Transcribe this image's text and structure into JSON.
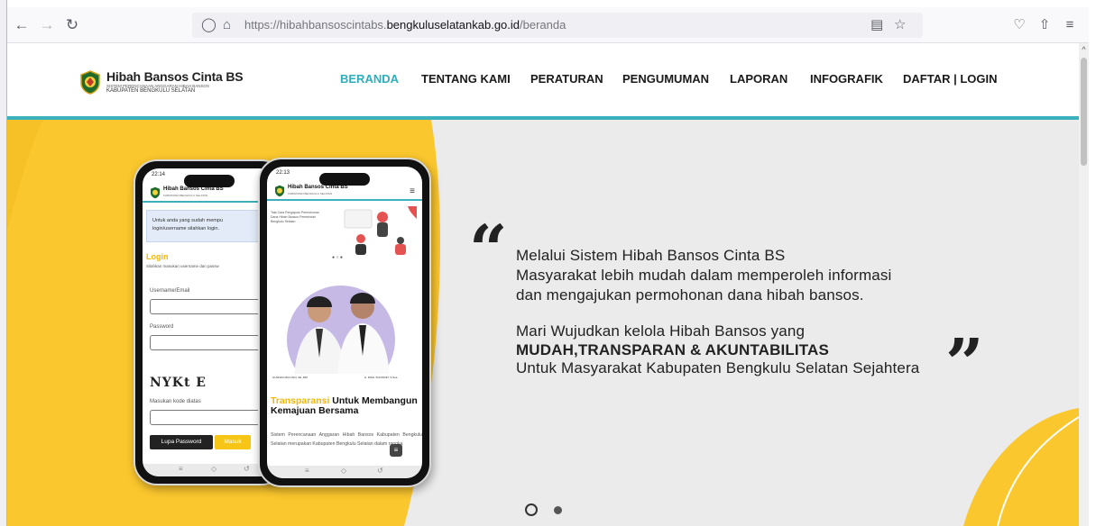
{
  "browser": {
    "url_prefix": "https://hibahbansoscintabs.",
    "url_domain": "bengkuluselatankab.go.id",
    "url_path": "/beranda",
    "icons": [
      "back-arrow-icon",
      "forward-arrow-icon",
      "reload-icon",
      "shield-icon",
      "lock-icon",
      "reader-view-icon",
      "bookmark-star-icon",
      "pocket-icon",
      "share-icon",
      "menu-icon"
    ]
  },
  "site": {
    "logo_title": "Hibah Bansos Cinta BS",
    "logo_subtitle": "SISTEM PERENCANAAN ANGGARAN HIBAH BANSOS",
    "logo_region": "KABUPATEN BENGKULU SELATAN",
    "nav": [
      {
        "label": "BERANDA",
        "active": true
      },
      {
        "label": "TENTANG KAMI",
        "active": false
      },
      {
        "label": "PERATURAN",
        "active": false
      },
      {
        "label": "PENGUMUMAN",
        "active": false
      },
      {
        "label": "LAPORAN",
        "active": false
      },
      {
        "label": "INFOGRAFIK",
        "active": false
      },
      {
        "label": "DAFTAR | LOGIN",
        "active": false
      }
    ]
  },
  "phone_left": {
    "status_time": "22:14",
    "title": "Hibah Bansos Cinta BS",
    "subtitle": "KABUPATEN BENGKULU SELATAN",
    "alert_line1": "Untuk anda yang sudah mempu",
    "alert_line2": "login/username silahkan login.",
    "login_title": "Login",
    "login_hint": "Silahkan masukan username dan passw",
    "username_label": "Username/Email",
    "password_label": "Password",
    "captcha_text": "NYKt E",
    "captcha_label": "Masukan kode diatas",
    "forgot_button": "Lupa Password",
    "submit_button": "Masuk"
  },
  "phone_right": {
    "status_time": "22:13",
    "title": "Hibah Bansos Cinta BS",
    "subtitle": "KABUPATEN BENGKULU SELATAN",
    "banner_text": "Tata Cara Pengajuan Permohonan Dana Hibah Bansos Pemerintah Bengkulu Selatan",
    "caption_left": "GUSNAN MULYADI, SE.,MM",
    "caption_right": "H. RIFAI TAJUDDIN, S.Sos.",
    "heading_highlight": "Transparansi",
    "heading_rest": "Untuk Membangun Kemajuan Bersama",
    "body": "Sistem Perencanaan Anggaran Hibah Bansos Kabupaten Bengkulu Selatan merupakan Kabupaten Bengkulu Selatan dalam rangka"
  },
  "quote": {
    "line1": "Melalui Sistem Hibah Bansos Cinta BS",
    "line2": "Masyarakat lebih mudah dalam memperoleh informasi",
    "line3": "dan mengajukan permohonan dana hibah bansos.",
    "line4": "Mari Wujudkan kelola Hibah Bansos yang",
    "line5": "MUDAH,TRANSPARAN & AKUNTABILITAS",
    "line6": "Untuk Masyarakat Kabupaten Bengkulu Selatan Sejahtera"
  },
  "carousel": {
    "slides": 2,
    "active_index": 0
  },
  "colors": {
    "accent": "#2eaebd",
    "hero_yellow": "#fbc72e",
    "hero_bg": "#ebebeb"
  }
}
